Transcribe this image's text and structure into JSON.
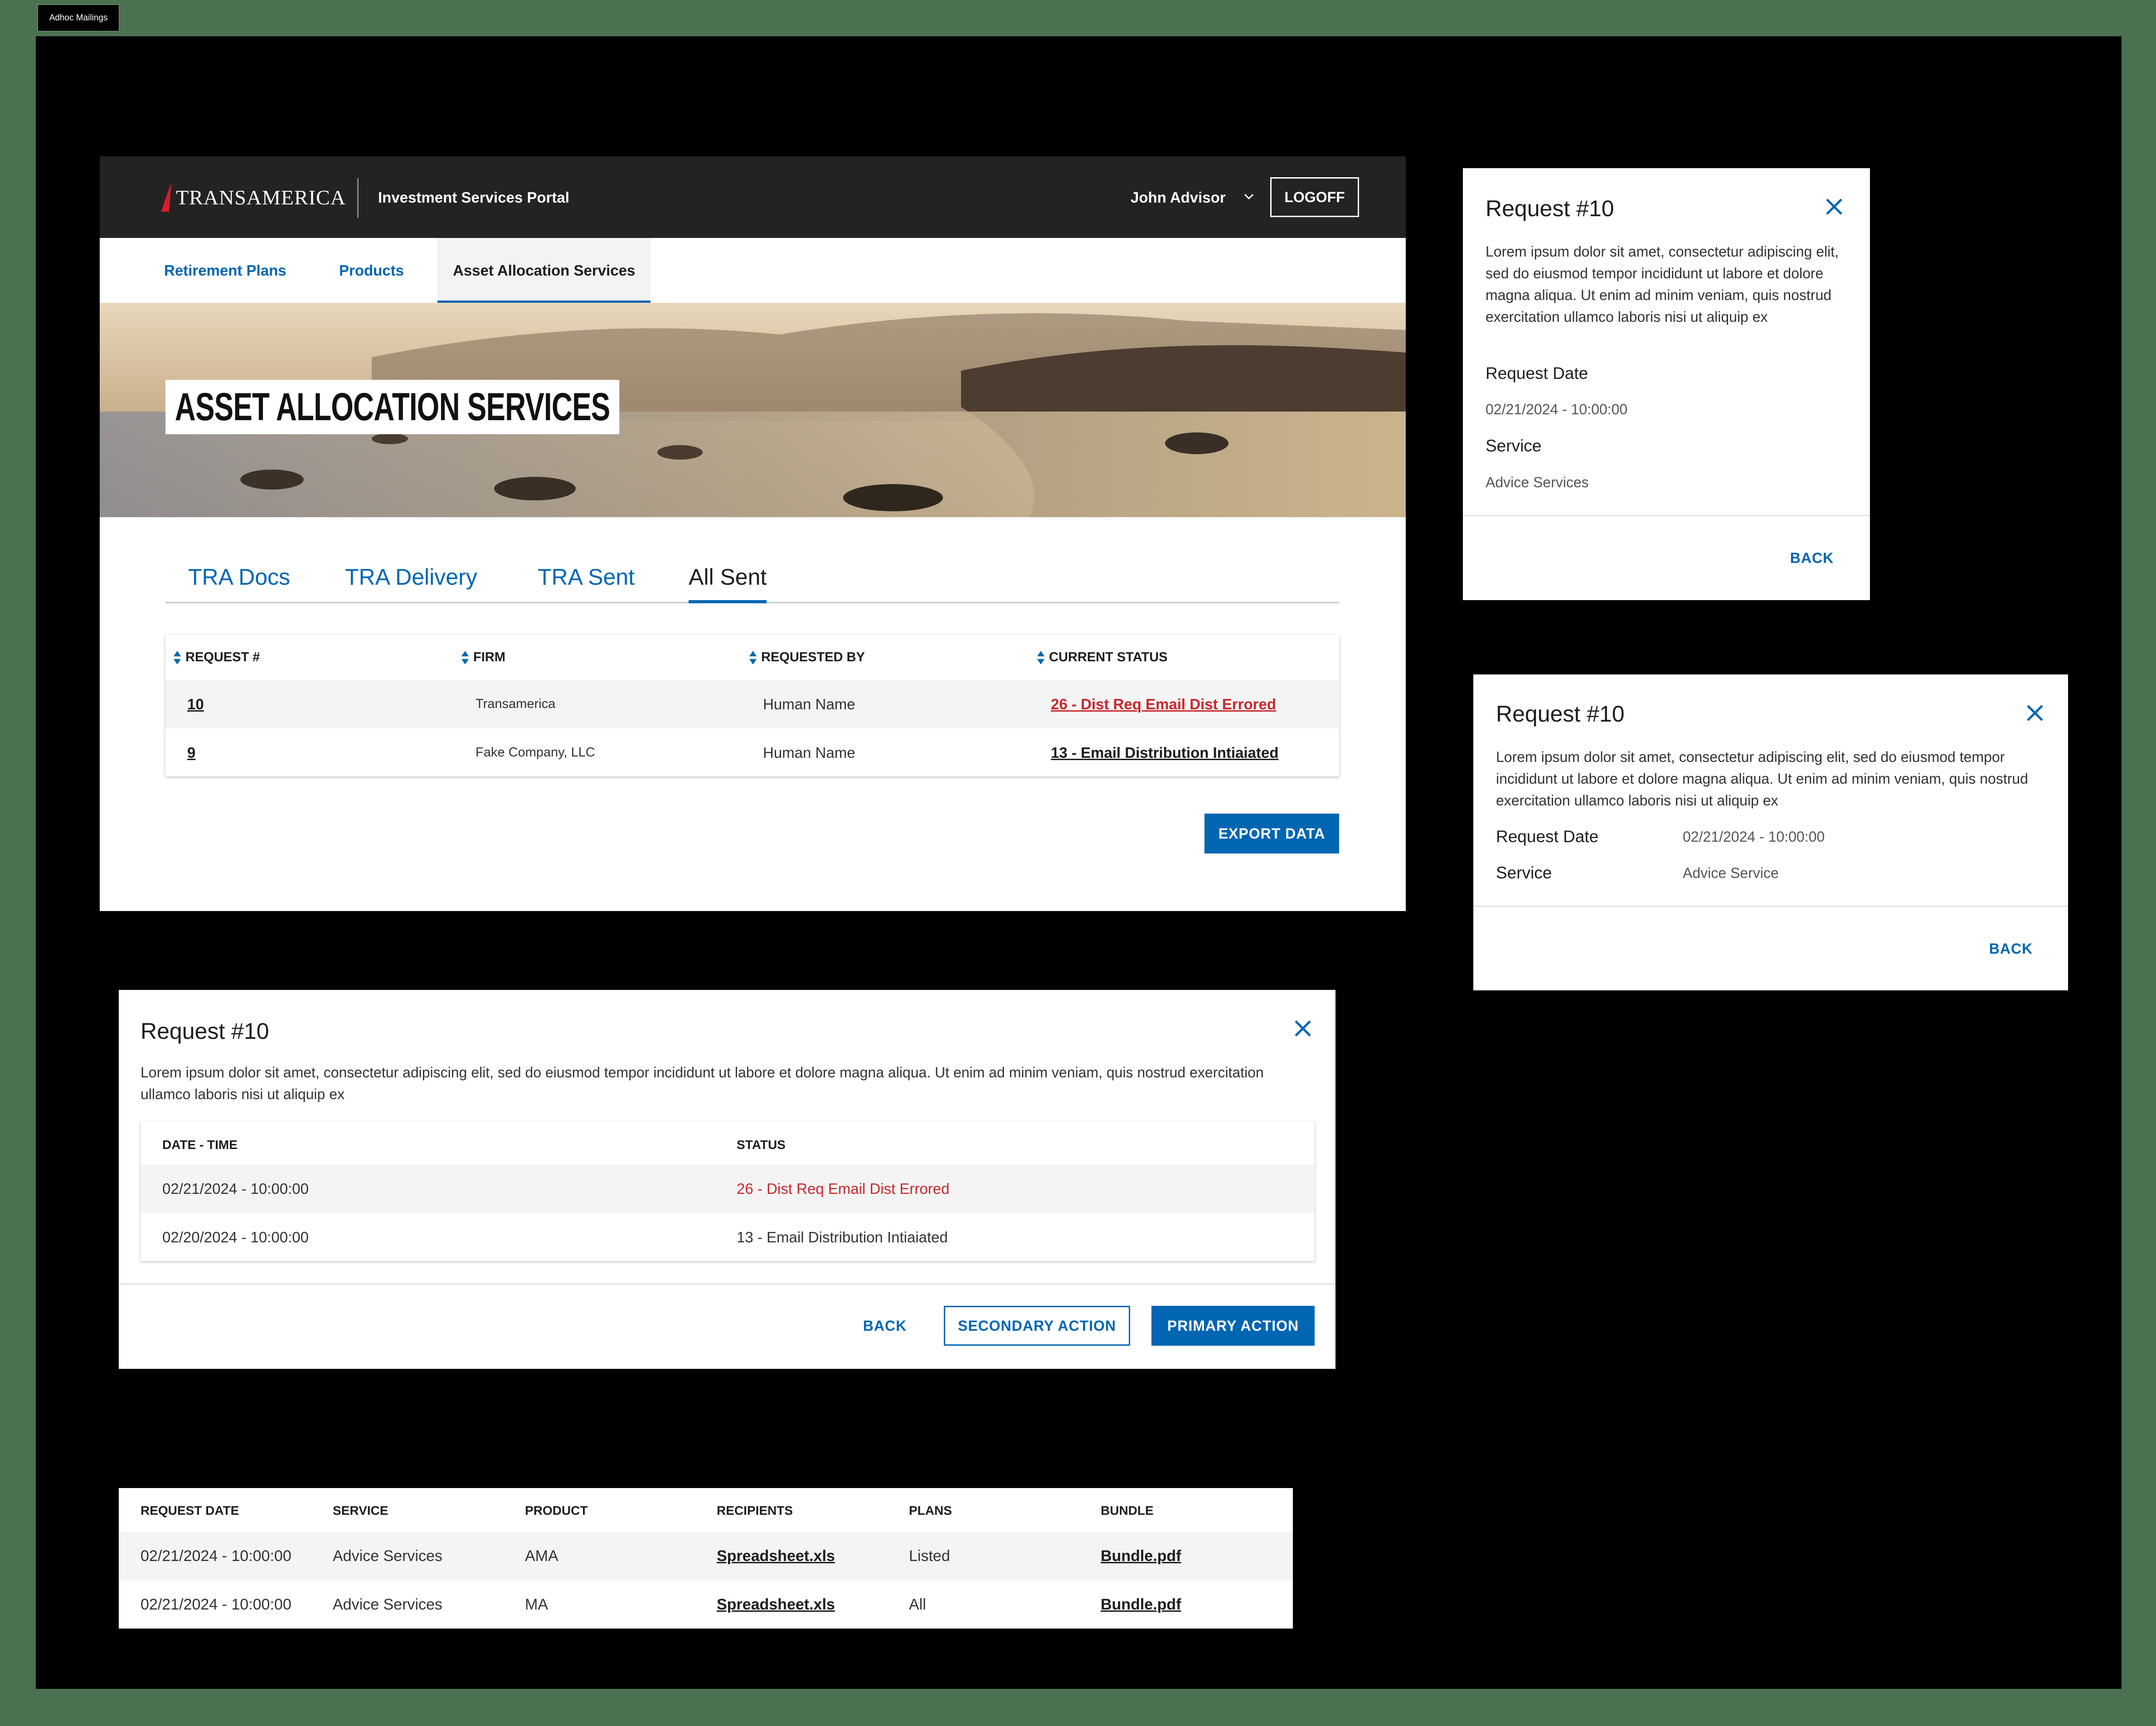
{
  "frame_label": "Adhoc Mailings",
  "header": {
    "brand": "TRANSAMERICA",
    "portal_title": "Investment Services Portal",
    "user_name": "John Advisor",
    "logoff_label": "LOGOFF"
  },
  "subnav": [
    "Retirement Plans",
    "Products",
    "Asset Allocation Services"
  ],
  "hero_title": "ASSET ALLOCATION SERVICES",
  "tabs": [
    "TRA Docs",
    "TRA Delivery",
    "TRA Sent",
    "All Sent"
  ],
  "requests_table": {
    "headers": [
      "REQUEST #",
      "FIRM",
      "REQUESTED BY",
      "CURRENT STATUS"
    ],
    "rows": [
      {
        "id": "10",
        "firm": "Transamerica",
        "requested_by": "Human Name",
        "status": "26 - Dist Req Email Dist Errored"
      },
      {
        "id": "9",
        "firm": "Fake Company, LLC",
        "requested_by": "Human Name",
        "status": "13 - Email Distribution Intiaiated"
      }
    ]
  },
  "export_label": "EXPORT DATA",
  "modal_a": {
    "title": "Request #10",
    "body": "Lorem ipsum dolor sit amet, consectetur adipiscing elit, sed do eiusmod tempor incididunt ut labore et dolore magna aliqua. Ut enim ad minim veniam, quis nostrud exercitation ullamco laboris nisi ut aliquip ex",
    "date_label": "Request Date",
    "date_value": "02/21/2024 - 10:00:00",
    "service_label": "Service",
    "service_value": "Advice Services",
    "back_label": "BACK"
  },
  "modal_b": {
    "title": "Request #10",
    "body": "Lorem ipsum dolor sit amet, consectetur adipiscing elit, sed do eiusmod tempor incididunt ut labore et dolore magna aliqua. Ut enim ad minim veniam, quis nostrud exercitation ullamco laboris nisi ut aliquip ex",
    "date_label": "Request Date",
    "date_value": "02/21/2024 - 10:00:00",
    "service_label": "Service",
    "service_value": "Advice Service",
    "back_label": "BACK"
  },
  "modal_c": {
    "title": "Request #10",
    "body": "Lorem ipsum dolor sit amet, consectetur adipiscing elit, sed do eiusmod tempor incididunt ut labore et dolore magna aliqua. Ut enim ad minim veniam, quis nostrud exercitation ullamco laboris nisi ut aliquip ex",
    "headers": [
      "DATE - TIME",
      "STATUS"
    ],
    "rows": [
      {
        "datetime": "02/21/2024 - 10:00:00",
        "status": "26 - Dist Req Email Dist Errored"
      },
      {
        "datetime": "02/20/2024 - 10:00:00",
        "status": "13 - Email Distribution Intiaiated"
      }
    ],
    "back_label": "BACK",
    "secondary_label": "SECONDARY ACTION",
    "primary_label": "PRIMARY ACTION"
  },
  "details_table": {
    "headers": [
      "REQUEST DATE",
      "SERVICE",
      "PRODUCT",
      "RECIPIENTS",
      "PLANS",
      "BUNDLE"
    ],
    "rows": [
      {
        "date": "02/21/2024 - 10:00:00",
        "service": "Advice Services",
        "product": "AMA",
        "recipients": "Spreadsheet.xls",
        "plans": "Listed",
        "bundle": "Bundle.pdf"
      },
      {
        "date": "02/21/2024 - 10:00:00",
        "service": "Advice Services",
        "product": "MA",
        "recipients": "Spreadsheet.xls",
        "plans": "All",
        "bundle": "Bundle.pdf"
      }
    ]
  },
  "colors": {
    "accent": "#0066b2",
    "error": "#c8282c",
    "header_bg": "#232323",
    "canvas": "#4a7150"
  }
}
